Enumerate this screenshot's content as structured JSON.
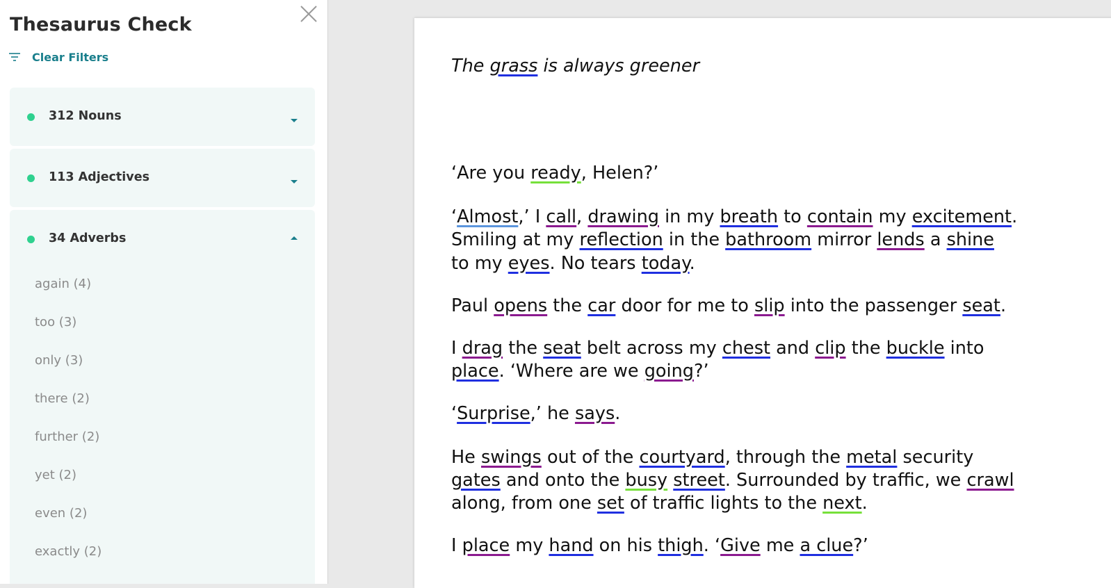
{
  "sidebar": {
    "title": "Thesaurus Check",
    "clear_filters": "Clear Filters",
    "groups": [
      {
        "label": "312 Nouns",
        "expanded": false
      },
      {
        "label": "113 Adjectives",
        "expanded": false
      },
      {
        "label": "34 Adverbs",
        "expanded": true,
        "items": [
          "again (4)",
          "too (3)",
          "only (3)",
          "there (2)",
          "further (2)",
          "yet (2)",
          "even (2)",
          "exactly (2)"
        ]
      }
    ]
  },
  "document": {
    "title": [
      {
        "t": "The "
      },
      {
        "t": "grass",
        "u": "noun"
      },
      {
        "t": " is always greener"
      }
    ],
    "lines": [
      [
        {
          "t": "‘Are you "
        },
        {
          "t": "ready",
          "u": "adj"
        },
        {
          "t": ", Helen?’"
        }
      ],
      [
        {
          "t": "‘"
        },
        {
          "t": "Almost",
          "u": "adv"
        },
        {
          "t": ",’ I "
        },
        {
          "t": "call",
          "u": "verb"
        },
        {
          "t": ", "
        },
        {
          "t": "drawing",
          "u": "verb"
        },
        {
          "t": " in my "
        },
        {
          "t": "breath",
          "u": "noun"
        },
        {
          "t": " to "
        },
        {
          "t": "contain",
          "u": "verb"
        },
        {
          "t": " my "
        },
        {
          "t": "excitement",
          "u": "noun"
        },
        {
          "t": "."
        }
      ],
      [
        {
          "t": "Smiling at my "
        },
        {
          "t": "reflection",
          "u": "noun"
        },
        {
          "t": " in the "
        },
        {
          "t": "bathroom",
          "u": "noun"
        },
        {
          "t": " mirror "
        },
        {
          "t": "lends",
          "u": "verb"
        },
        {
          "t": " a "
        },
        {
          "t": "shine",
          "u": "noun"
        }
      ],
      [
        {
          "t": "to my "
        },
        {
          "t": "eyes",
          "u": "noun"
        },
        {
          "t": ". No tears "
        },
        {
          "t": "today",
          "u": "noun"
        },
        {
          "t": "."
        }
      ],
      [
        {
          "t": "Paul "
        },
        {
          "t": "opens",
          "u": "verb"
        },
        {
          "t": " the "
        },
        {
          "t": "car",
          "u": "noun"
        },
        {
          "t": " door for me to "
        },
        {
          "t": "slip",
          "u": "verb"
        },
        {
          "t": " into the passenger "
        },
        {
          "t": "seat",
          "u": "noun"
        },
        {
          "t": "."
        }
      ],
      [
        {
          "t": "I "
        },
        {
          "t": "drag",
          "u": "verb"
        },
        {
          "t": " the "
        },
        {
          "t": "seat",
          "u": "noun"
        },
        {
          "t": " belt across my "
        },
        {
          "t": "chest",
          "u": "noun"
        },
        {
          "t": " and "
        },
        {
          "t": "clip",
          "u": "verb"
        },
        {
          "t": " the "
        },
        {
          "t": "buckle",
          "u": "noun"
        },
        {
          "t": " into"
        }
      ],
      [
        {
          "t": "place",
          "u": "noun"
        },
        {
          "t": ". ‘Where are we "
        },
        {
          "t": "going",
          "u": "verb"
        },
        {
          "t": "?’"
        }
      ],
      [
        {
          "t": "‘"
        },
        {
          "t": "Surprise",
          "u": "noun"
        },
        {
          "t": ",’ he "
        },
        {
          "t": "says",
          "u": "verb"
        },
        {
          "t": "."
        }
      ],
      [
        {
          "t": "He "
        },
        {
          "t": "swings",
          "u": "verb"
        },
        {
          "t": " out of the "
        },
        {
          "t": "courtyard",
          "u": "noun"
        },
        {
          "t": ", through the "
        },
        {
          "t": "metal",
          "u": "noun"
        },
        {
          "t": " security"
        }
      ],
      [
        {
          "t": "gates",
          "u": "noun"
        },
        {
          "t": " and onto the "
        },
        {
          "t": "busy",
          "u": "adj"
        },
        {
          "t": " "
        },
        {
          "t": "street",
          "u": "noun"
        },
        {
          "t": ". Surrounded by traffic, we "
        },
        {
          "t": "crawl",
          "u": "verb"
        }
      ],
      [
        {
          "t": "along, from one "
        },
        {
          "t": "set",
          "u": "noun"
        },
        {
          "t": " of traffic lights to the "
        },
        {
          "t": "next",
          "u": "adj"
        },
        {
          "t": "."
        }
      ],
      [
        {
          "t": "I "
        },
        {
          "t": "place",
          "u": "verb"
        },
        {
          "t": " my "
        },
        {
          "t": "hand",
          "u": "noun"
        },
        {
          "t": " on his "
        },
        {
          "t": "thigh",
          "u": "noun"
        },
        {
          "t": ". ‘"
        },
        {
          "t": "Give",
          "u": "verb"
        },
        {
          "t": " me "
        },
        {
          "t": "a clue",
          "u": "noun"
        },
        {
          "t": "?’"
        }
      ]
    ]
  },
  "colors": {
    "dot_green": "#2fd18f",
    "accent_teal": "#1a7f8c",
    "underline_noun": "#1f2fe0",
    "underline_verb": "#8b1a8f",
    "underline_adjective": "#76e03a",
    "underline_adverb": "#5b95dd"
  },
  "icons": [
    "close-icon",
    "filter-icon",
    "chevron-down-icon",
    "chevron-up-icon",
    "status-dot-icon"
  ]
}
